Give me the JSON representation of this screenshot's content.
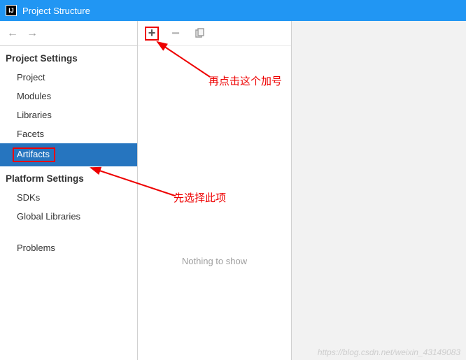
{
  "titlebar": {
    "title": "Project Structure"
  },
  "nav": {
    "back": "←",
    "forward": "→"
  },
  "sidebar": {
    "section1": "Project Settings",
    "items1": {
      "project": "Project",
      "modules": "Modules",
      "libraries": "Libraries",
      "facets": "Facets",
      "artifacts": "Artifacts"
    },
    "section2": "Platform Settings",
    "items2": {
      "sdks": "SDKs",
      "global_libraries": "Global Libraries"
    },
    "problems": "Problems"
  },
  "toolbar": {
    "plus": "+",
    "minus": "−"
  },
  "content": {
    "empty": "Nothing to show"
  },
  "annotations": {
    "plus_hint": "再点击这个加号",
    "select_hint": "先选择此项"
  },
  "watermark": "https://blog.csdn.net/weixin_43149083"
}
